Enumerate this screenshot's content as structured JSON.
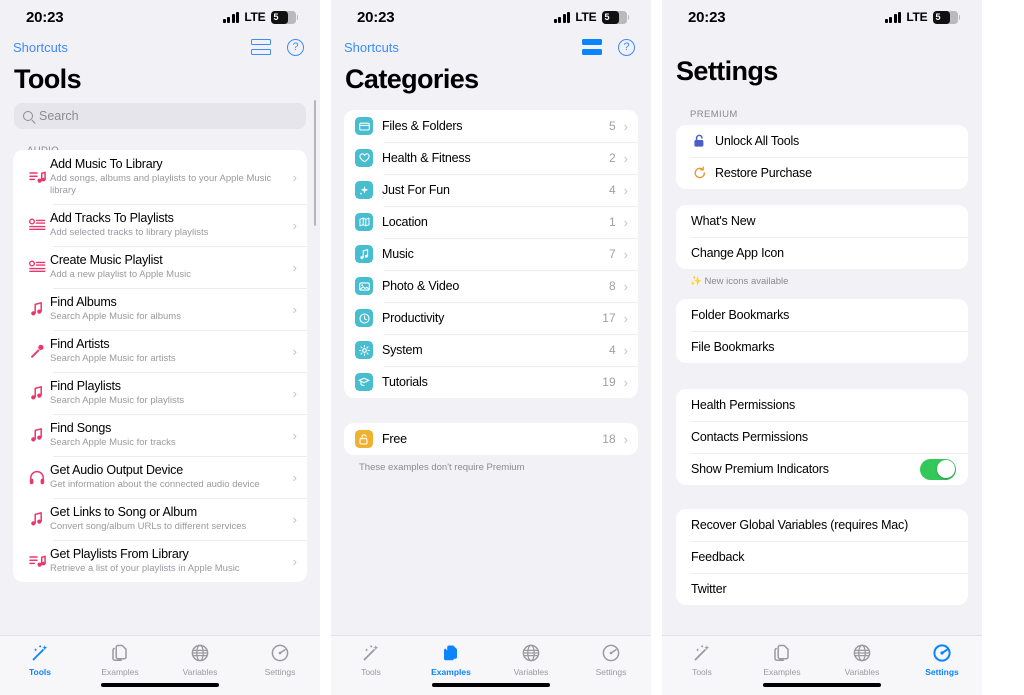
{
  "status_bar": {
    "time": "20:23",
    "network": "LTE",
    "battery_level": "5"
  },
  "colors": {
    "accent_blue": "#0a84ff",
    "link_blue": "#3d8bfd",
    "category_teal": "#47bdd0",
    "free_orange": "#f0b030",
    "music_pink": "#e8376a",
    "toggle_green": "#34c759",
    "page_bg": "#f2f1f6"
  },
  "tabs": [
    {
      "label": "Tools",
      "icon": "wand-sparkles-icon"
    },
    {
      "label": "Examples",
      "icon": "documents-icon"
    },
    {
      "label": "Variables",
      "icon": "globe-icon"
    },
    {
      "label": "Settings",
      "icon": "gauge-icon"
    }
  ],
  "tools_screen": {
    "back_label": "Shortcuts",
    "title": "Tools",
    "search_placeholder": "Search",
    "search_value": "",
    "active_tab": "Tools",
    "section_header": "AUDIO",
    "items": [
      {
        "title": "Add Music To Library",
        "subtitle": "Add songs, albums and playlists to your Apple Music library",
        "icon": "music-list-icon"
      },
      {
        "title": "Add Tracks To Playlists",
        "subtitle": "Add selected tracks to library playlists",
        "icon": "playlist-icon"
      },
      {
        "title": "Create Music Playlist",
        "subtitle": "Add a new playlist to Apple Music",
        "icon": "playlist-icon"
      },
      {
        "title": "Find Albums",
        "subtitle": "Search Apple Music for albums",
        "icon": "music-note-icon"
      },
      {
        "title": "Find Artists",
        "subtitle": "Search Apple Music for artists",
        "icon": "microphone-icon"
      },
      {
        "title": "Find Playlists",
        "subtitle": "Search Apple Music for playlists",
        "icon": "music-note-icon"
      },
      {
        "title": "Find Songs",
        "subtitle": "Search Apple Music for tracks",
        "icon": "music-note-icon"
      },
      {
        "title": "Get Audio Output Device",
        "subtitle": "Get information about the connected audio device",
        "icon": "headphones-icon"
      },
      {
        "title": "Get Links to Song or Album",
        "subtitle": "Convert song/album URLs to different services",
        "icon": "music-note-icon"
      },
      {
        "title": "Get Playlists From Library",
        "subtitle": "Retrieve a list of your playlists in Apple Music",
        "icon": "music-list-icon"
      }
    ]
  },
  "categories_screen": {
    "back_label": "Shortcuts",
    "title": "Categories",
    "active_tab": "Examples",
    "items": [
      {
        "label": "Files & Folders",
        "count": "5",
        "icon": "folder-icon"
      },
      {
        "label": "Health & Fitness",
        "count": "2",
        "icon": "heart-icon"
      },
      {
        "label": "Just For Fun",
        "count": "4",
        "icon": "sparkle-icon"
      },
      {
        "label": "Location",
        "count": "1",
        "icon": "map-icon"
      },
      {
        "label": "Music",
        "count": "7",
        "icon": "music-note-icon"
      },
      {
        "label": "Photo & Video",
        "count": "8",
        "icon": "photo-icon"
      },
      {
        "label": "Productivity",
        "count": "17",
        "icon": "clock-icon"
      },
      {
        "label": "System",
        "count": "4",
        "icon": "gear-icon"
      },
      {
        "label": "Tutorials",
        "count": "19",
        "icon": "graduation-cap-icon"
      }
    ],
    "free_item": {
      "label": "Free",
      "count": "18",
      "icon": "unlock-icon"
    },
    "free_footer": "These examples don't require Premium"
  },
  "settings_screen": {
    "title": "Settings",
    "active_tab": "Settings",
    "premium_header": "PREMIUM",
    "premium_items": [
      {
        "label": "Unlock All Tools",
        "icon": "unlock-icon"
      },
      {
        "label": "Restore Purchase",
        "icon": "restore-arrow-icon"
      }
    ],
    "about_items": [
      {
        "label": "What's New"
      },
      {
        "label": "Change App Icon"
      }
    ],
    "about_footer": "New icons available",
    "about_footer_icon": "sparkles-icon",
    "bookmark_items": [
      {
        "label": "Folder Bookmarks"
      },
      {
        "label": "File Bookmarks"
      }
    ],
    "permission_items": [
      {
        "label": "Health Permissions",
        "type": "link"
      },
      {
        "label": "Contacts Permissions",
        "type": "link"
      },
      {
        "label": "Show Premium Indicators",
        "type": "toggle",
        "value": "on"
      }
    ],
    "support_items": [
      {
        "label": "Recover Global Variables (requires Mac)"
      },
      {
        "label": "Feedback"
      },
      {
        "label": "Twitter"
      }
    ]
  }
}
